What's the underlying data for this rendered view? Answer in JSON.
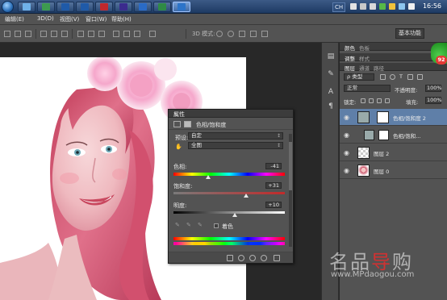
{
  "taskbar": {
    "apps": [
      {
        "icon": "explorer-icon",
        "color": "#6fb1e8"
      },
      {
        "icon": "excel-icon",
        "color": "#3d9a4f"
      },
      {
        "icon": "photoshop-icon",
        "color": "#1f5aa8"
      },
      {
        "icon": "photoshop-icon",
        "color": "#1f5aa8"
      },
      {
        "icon": "acrobat-icon",
        "color": "#c0282d"
      },
      {
        "icon": "premiere-icon",
        "color": "#3b2b8d"
      },
      {
        "icon": "word-icon",
        "color": "#2a6bc6"
      },
      {
        "icon": "excel-icon",
        "color": "#2f8a45"
      },
      {
        "icon": "photoshop-icon",
        "color": "#2c74c9",
        "active": true
      }
    ],
    "language": "CH",
    "clock": "16:56"
  },
  "menu": [
    "编辑(E)",
    "3D(D)",
    "视图(V)",
    "窗口(W)",
    "帮助(H)"
  ],
  "options": {
    "mode_label": "3D 模式:",
    "workspace": "基本功能"
  },
  "properties": {
    "title": "属性",
    "close": "»",
    "panel_name": "色相/饱和度",
    "preset_label": "预设:",
    "preset_value": "自定",
    "channel_value": "全图",
    "hue_label": "色相:",
    "hue_value": "-41",
    "saturation_label": "饱和度:",
    "saturation_value": "+31",
    "lightness_label": "明度:",
    "lightness_value": "+10",
    "colorize_label": "着色"
  },
  "panels": {
    "top_tabs": [
      "颜色",
      "色板"
    ],
    "mid_tabs": [
      "调整",
      "样式"
    ],
    "layer_tabs": [
      "图层",
      "通道",
      "路径"
    ],
    "kind_filter": "ρ 类型",
    "blend_mode": "正常",
    "opacity_label": "不透明度:",
    "opacity_value": "100%",
    "lock_label": "锁定:",
    "fill_label": "填充:",
    "fill_value": "100%"
  },
  "layers": [
    {
      "name": "色相/饱和度 2",
      "selected": true,
      "type": "adjustment"
    },
    {
      "name": "色相/饱和...",
      "selected": false,
      "type": "adjustment"
    },
    {
      "name": "图层 2",
      "selected": false,
      "type": "transparent"
    },
    {
      "name": "图层 0",
      "selected": false,
      "type": "photo"
    }
  ],
  "badge": "92",
  "watermark": {
    "logo_a": "名品",
    "logo_b": "导",
    "logo_c": "购",
    "url": "www.MPdaogou.com"
  },
  "colors": {
    "selection": "#5f7fa8",
    "panel": "#535353",
    "workspace": "#282828"
  }
}
